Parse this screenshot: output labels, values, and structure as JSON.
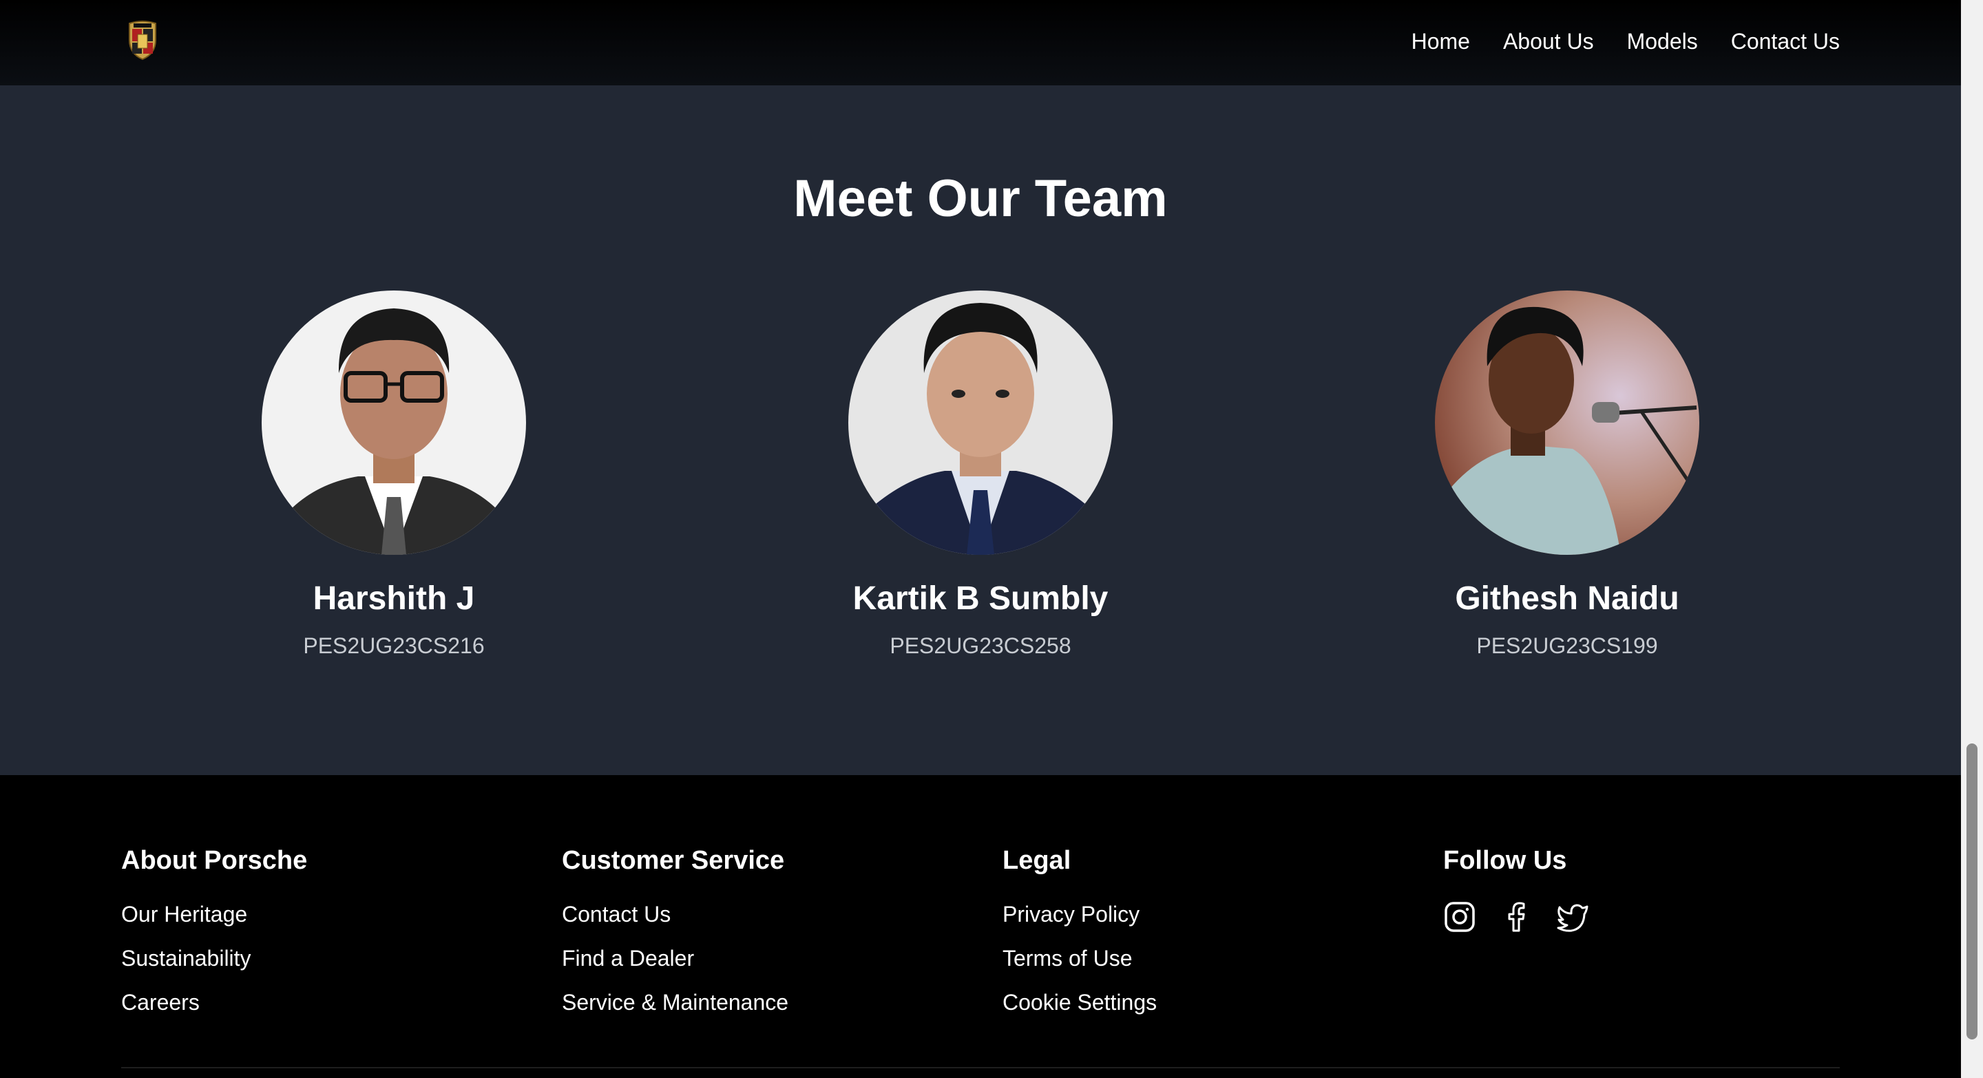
{
  "nav": {
    "logo": "porsche-crest",
    "links": [
      "Home",
      "About Us",
      "Models",
      "Contact Us"
    ]
  },
  "team": {
    "title": "Meet Our Team",
    "members": [
      {
        "name": "Harshith J",
        "id": "PES2UG23CS216"
      },
      {
        "name": "Kartik B Sumbly",
        "id": "PES2UG23CS258"
      },
      {
        "name": "Githesh Naidu",
        "id": "PES2UG23CS199"
      }
    ]
  },
  "footer": {
    "about": {
      "title": "About Porsche",
      "links": [
        "Our Heritage",
        "Sustainability",
        "Careers"
      ]
    },
    "service": {
      "title": "Customer Service",
      "links": [
        "Contact Us",
        "Find a Dealer",
        "Service & Maintenance"
      ]
    },
    "legal": {
      "title": "Legal",
      "links": [
        "Privacy Policy",
        "Terms of Use",
        "Cookie Settings"
      ]
    },
    "follow": {
      "title": "Follow Us",
      "icons": [
        "instagram-icon",
        "facebook-icon",
        "twitter-icon"
      ]
    }
  },
  "colors": {
    "nav_bg": "#000000",
    "team_bg": "#222834",
    "footer_bg": "#000000",
    "text": "#ffffff",
    "muted": "#c8ccd2"
  }
}
